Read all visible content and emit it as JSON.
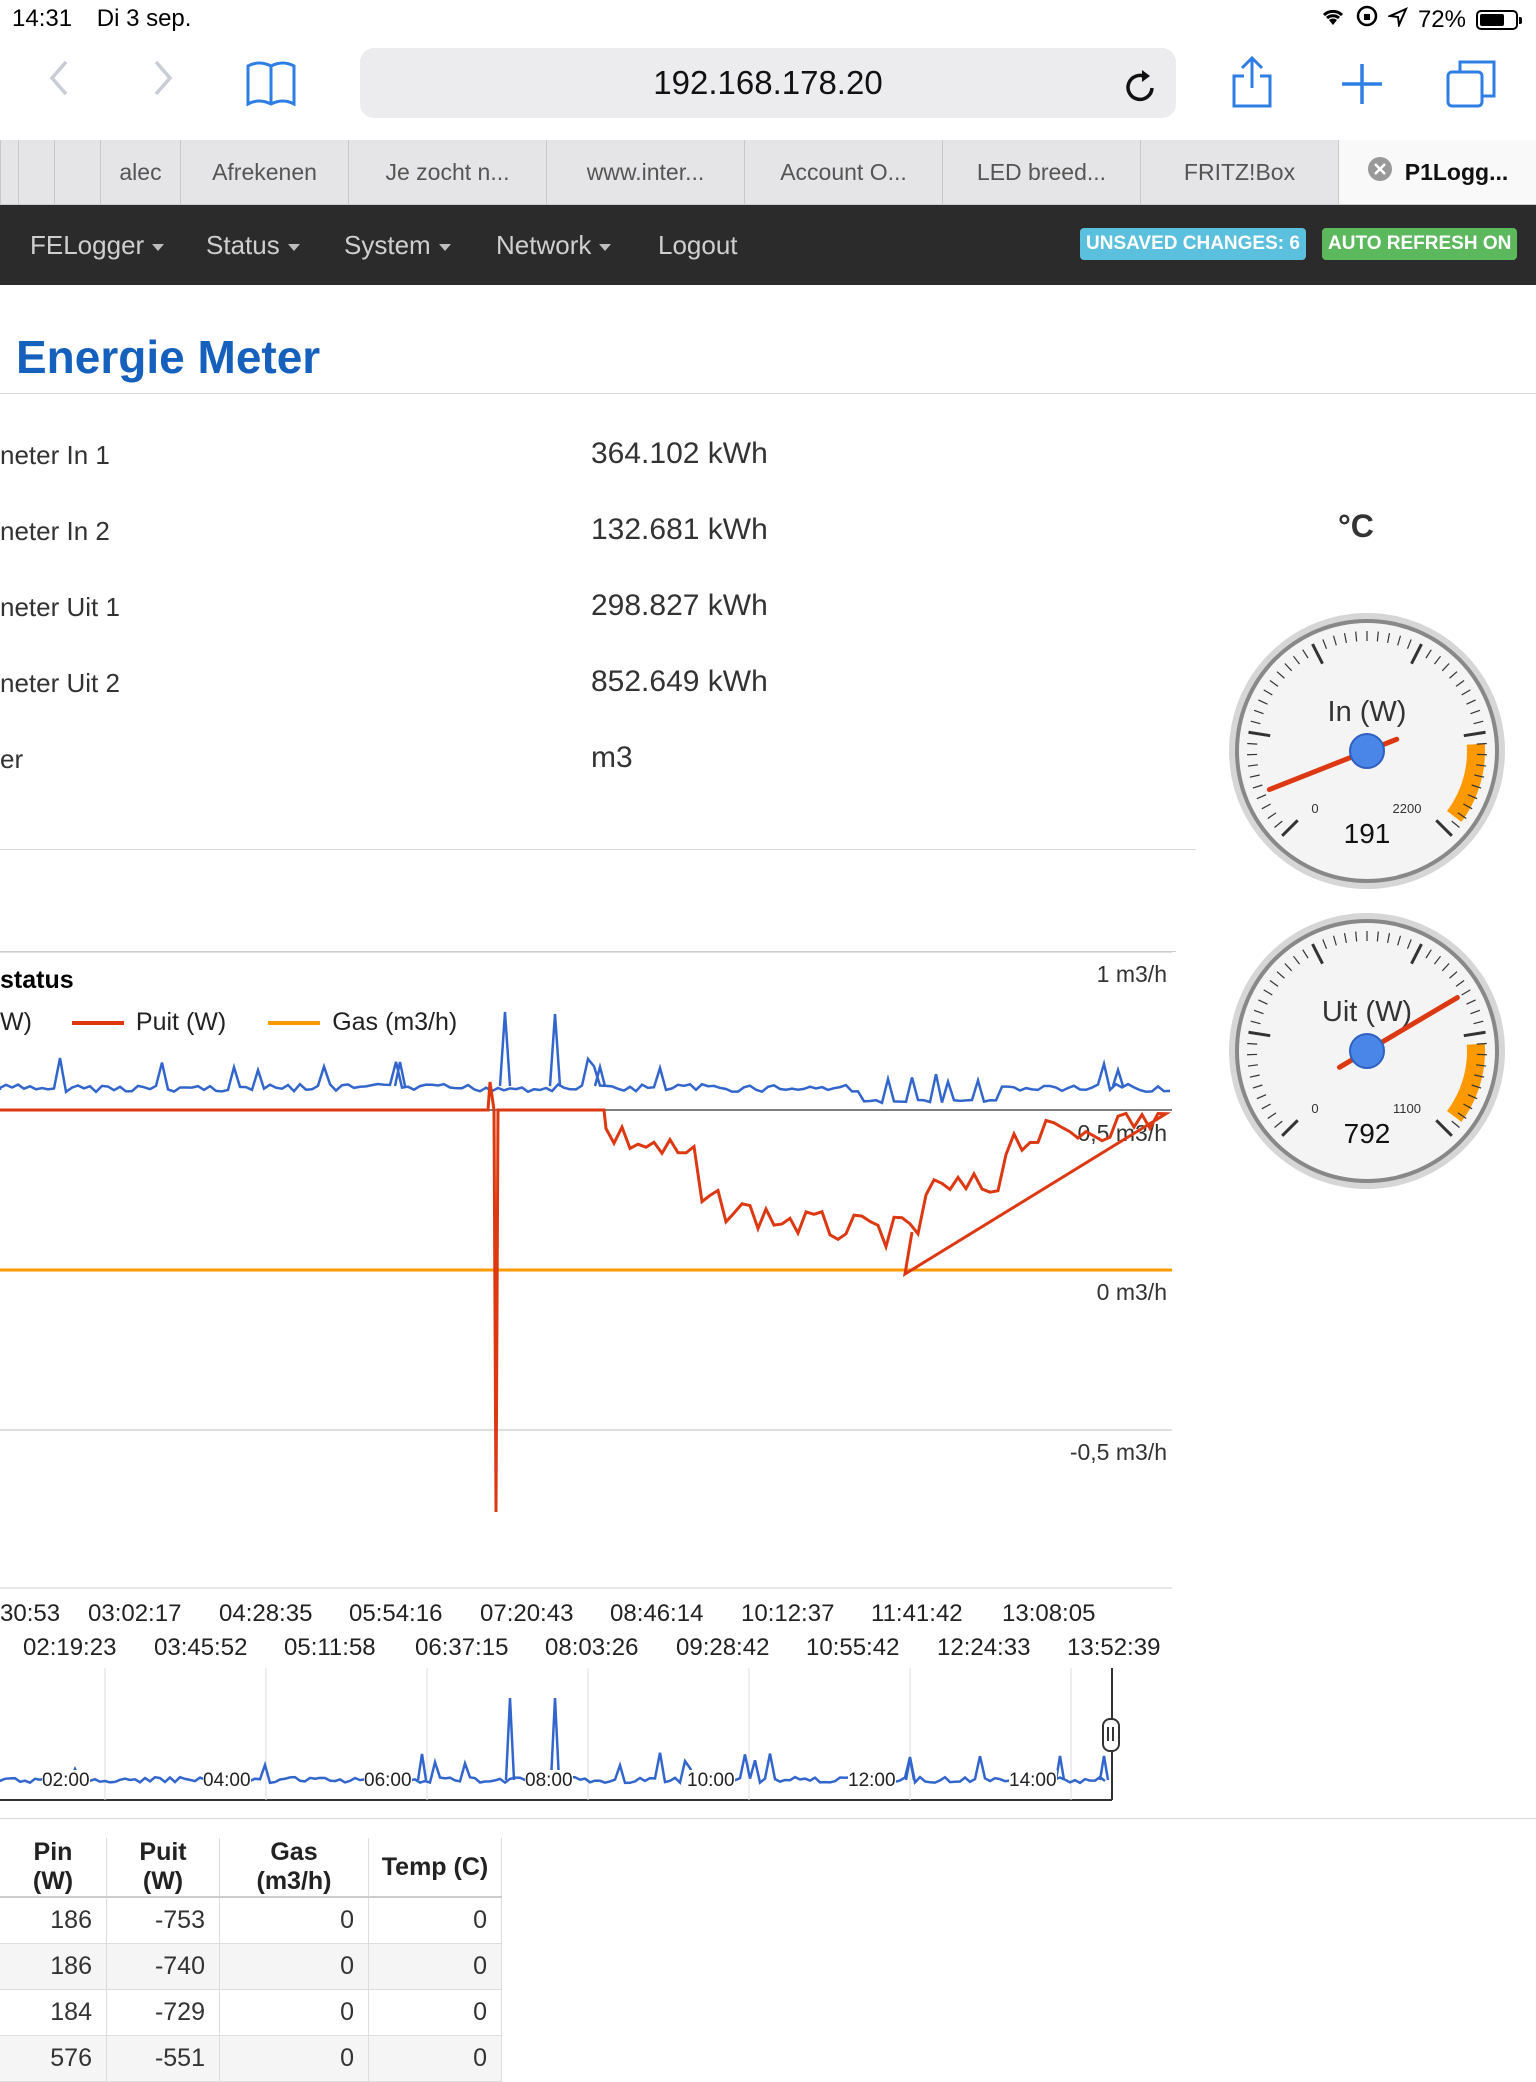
{
  "status_bar": {
    "time": "14:31",
    "date": "Di 3 sep.",
    "battery": "72%",
    "battery_level": 0.72
  },
  "browser": {
    "url": "192.168.178.20",
    "tabs": [
      "alec",
      "Afrekenen",
      "Je zocht n...",
      "www.inter...",
      "Account O...",
      "LED breed...",
      "FRITZ!Box",
      "P1Logg..."
    ],
    "active_tab_index": 7
  },
  "navbar": {
    "items": [
      "FELogger",
      "Status",
      "System",
      "Network",
      "Logout"
    ],
    "badges": [
      {
        "label": "UNSAVED CHANGES: 6",
        "color": "#5bc0de"
      },
      {
        "label": "AUTO REFRESH ON",
        "color": "#5cb85c"
      }
    ]
  },
  "page": {
    "title": "Energie Meter"
  },
  "meters": [
    {
      "label": "neter In 1",
      "value": "364.102 kWh"
    },
    {
      "label": "neter In 2",
      "value": "132.681 kWh"
    },
    {
      "label": "neter Uit 1",
      "value": "298.827 kWh"
    },
    {
      "label": "neter Uit 2",
      "value": "852.649 kWh"
    },
    {
      "label": "er",
      "value": "m3"
    }
  ],
  "temp_unit": "°C",
  "gauges": [
    {
      "title": "In (W)",
      "value": "191",
      "min_label": "0",
      "max_label": "2200",
      "value_num": 191,
      "max": 2200
    },
    {
      "title": "Uit (W)",
      "value": "792",
      "min_label": "0",
      "max_label": "1100",
      "value_num": 792,
      "max": 1100
    }
  ],
  "chart_data": {
    "type": "line",
    "title": "status",
    "legend": [
      {
        "name": "W)",
        "color": "#3366cc"
      },
      {
        "name": "Puit (W)",
        "color": "#dc3912"
      },
      {
        "name": "Gas (m3/h)",
        "color": "#ff9900"
      }
    ],
    "y_right_ticks": [
      "1 m3/h",
      "0,5 m3/h",
      "0 m3/h",
      "-0,5 m3/h"
    ],
    "x_ticks_row1": [
      "30:53",
      "03:02:17",
      "04:28:35",
      "05:54:16",
      "07:20:43",
      "08:46:14",
      "10:12:37",
      "11:41:42",
      "13:08:05"
    ],
    "x_ticks_row2": [
      "02:19:23",
      "03:45:52",
      "05:11:58",
      "06:37:15",
      "08:03:26",
      "09:28:42",
      "10:55:42",
      "12:24:33",
      "13:52:39"
    ],
    "overview_ticks": [
      "02:00",
      "04:00",
      "06:00",
      "08:00",
      "10:00",
      "12:00",
      "14:00"
    ],
    "gas_m3h": 0,
    "series_colors": {
      "pin": "#3366cc",
      "puit": "#dc3912",
      "gas": "#ff9900"
    }
  },
  "table": {
    "headers": [
      "Pin (W)",
      "Puit (W)",
      "Gas (m3/h)",
      "Temp (C)"
    ],
    "rows": [
      [
        "186",
        "-753",
        "0",
        "0"
      ],
      [
        "186",
        "-740",
        "0",
        "0"
      ],
      [
        "184",
        "-729",
        "0",
        "0"
      ],
      [
        "576",
        "-551",
        "0",
        "0"
      ]
    ]
  }
}
